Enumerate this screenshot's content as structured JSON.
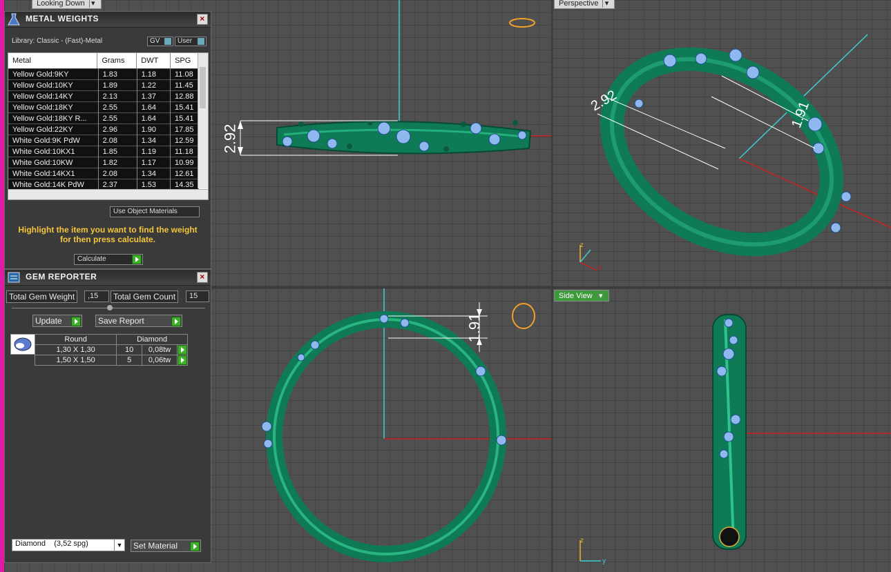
{
  "viewports": {
    "top_left_label": "Looking Down",
    "top_right_label": "Perspective",
    "bottom_right_label": "Side View",
    "dim_top_left": "2.92",
    "dim_perspective_a": "2.92",
    "dim_perspective_b": "1.91",
    "dim_bottom_left": "1.91",
    "axis_z": "z",
    "axis_y": "y",
    "axis_x": "x"
  },
  "metal_weights": {
    "title": "METAL WEIGHTS",
    "library": "Library: Classic - (Fast)-Metal",
    "gv_label": "GV",
    "user_label": "User",
    "columns": [
      "Metal",
      "Grams",
      "DWT",
      "SPG"
    ],
    "rows": [
      [
        "Yellow Gold:9KY",
        "1.83",
        "1.18",
        "11.08"
      ],
      [
        "Yellow Gold:10KY",
        "1.89",
        "1.22",
        "11.45"
      ],
      [
        "Yellow Gold:14KY",
        "2.13",
        "1.37",
        "12.88"
      ],
      [
        "Yellow Gold:18KY",
        "2.55",
        "1.64",
        "15.41"
      ],
      [
        "Yellow Gold:18KY R...",
        "2.55",
        "1.64",
        "15.41"
      ],
      [
        "Yellow Gold:22KY",
        "2.96",
        "1.90",
        "17.85"
      ],
      [
        "White Gold:9K PdW",
        "2.08",
        "1.34",
        "12.59"
      ],
      [
        "White Gold:10KX1",
        "1.85",
        "1.19",
        "11.18"
      ],
      [
        "White Gold:10KW",
        "1.82",
        "1.17",
        "10.99"
      ],
      [
        "White Gold:14KX1",
        "2.08",
        "1.34",
        "12.61"
      ],
      [
        "White Gold:14K PdW",
        "2.37",
        "1.53",
        "14.35"
      ]
    ],
    "use_object_materials": "Use Object Materials",
    "hint": "Highlight the item you want to find the weight for then press calculate.",
    "calculate": "Calculate"
  },
  "gem_reporter": {
    "title": "GEM REPORTER",
    "total_weight_label": "Total Gem Weight",
    "total_weight_value": ",15",
    "total_count_label": "Total Gem Count",
    "total_count_value": "15",
    "update": "Update",
    "save_report": "Save Report",
    "shape_header": "Round",
    "type_header": "Diamond",
    "rows": [
      [
        "1,30 X 1,30",
        "10",
        "0,08tw"
      ],
      [
        "1,50 X 1,50",
        "5",
        "0,06tw"
      ]
    ],
    "material_select": "Diamond    (3,52 spg)",
    "set_material": "Set Material"
  },
  "colors": {
    "ring_green": "#0f7a56",
    "gem_blue": "#8fb8ee",
    "accent_yellow": "#f5c53a",
    "button_green": "#3fae2a"
  }
}
